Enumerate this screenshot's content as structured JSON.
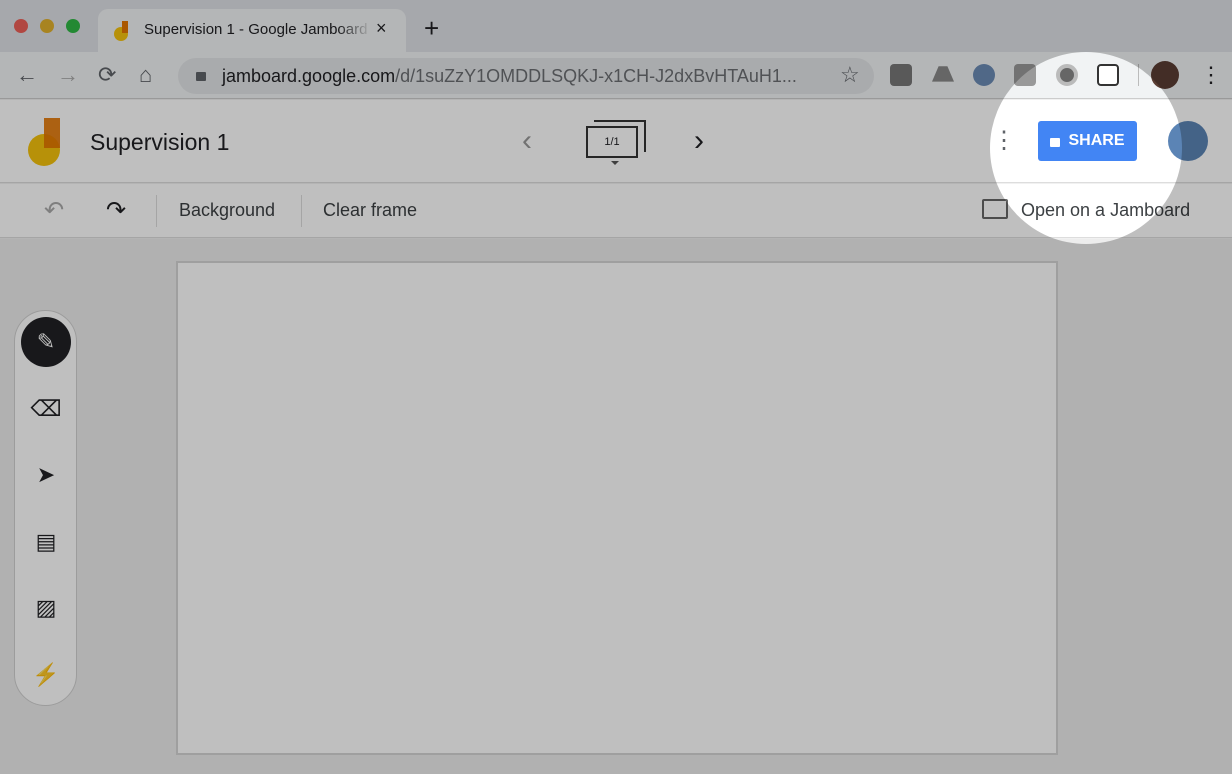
{
  "browser": {
    "tab_title": "Supervision 1 - Google Jamboard",
    "tab_close": "×",
    "new_tab": "+",
    "url_host": "jamboard.google.com",
    "url_path": "/d/1suZzY1OMDDLSQKJ-x1CH-J2dxBvHTAuH1...",
    "nav": {
      "back": "←",
      "forward": "→",
      "reload": "⟳",
      "home": "⌂",
      "star": "☆",
      "menu": "⋮"
    }
  },
  "app": {
    "title": "Supervision 1",
    "frame_counter": "1/1",
    "prev": "‹",
    "next": "›",
    "more": "⋮",
    "share_label": "SHARE",
    "share_color": "#4285f4",
    "background_label": "Background",
    "clear_frame_label": "Clear frame",
    "open_on_jamboard_label": "Open on a Jamboard",
    "undo": "↶",
    "redo": "↷"
  },
  "tools": [
    {
      "name": "pen-icon",
      "glyph": "✎"
    },
    {
      "name": "eraser-icon",
      "glyph": "⌫"
    },
    {
      "name": "select-icon",
      "glyph": "➤"
    },
    {
      "name": "sticky-note-icon",
      "glyph": "▤"
    },
    {
      "name": "image-icon",
      "glyph": "▨"
    },
    {
      "name": "laser-icon",
      "glyph": "⚡"
    }
  ]
}
